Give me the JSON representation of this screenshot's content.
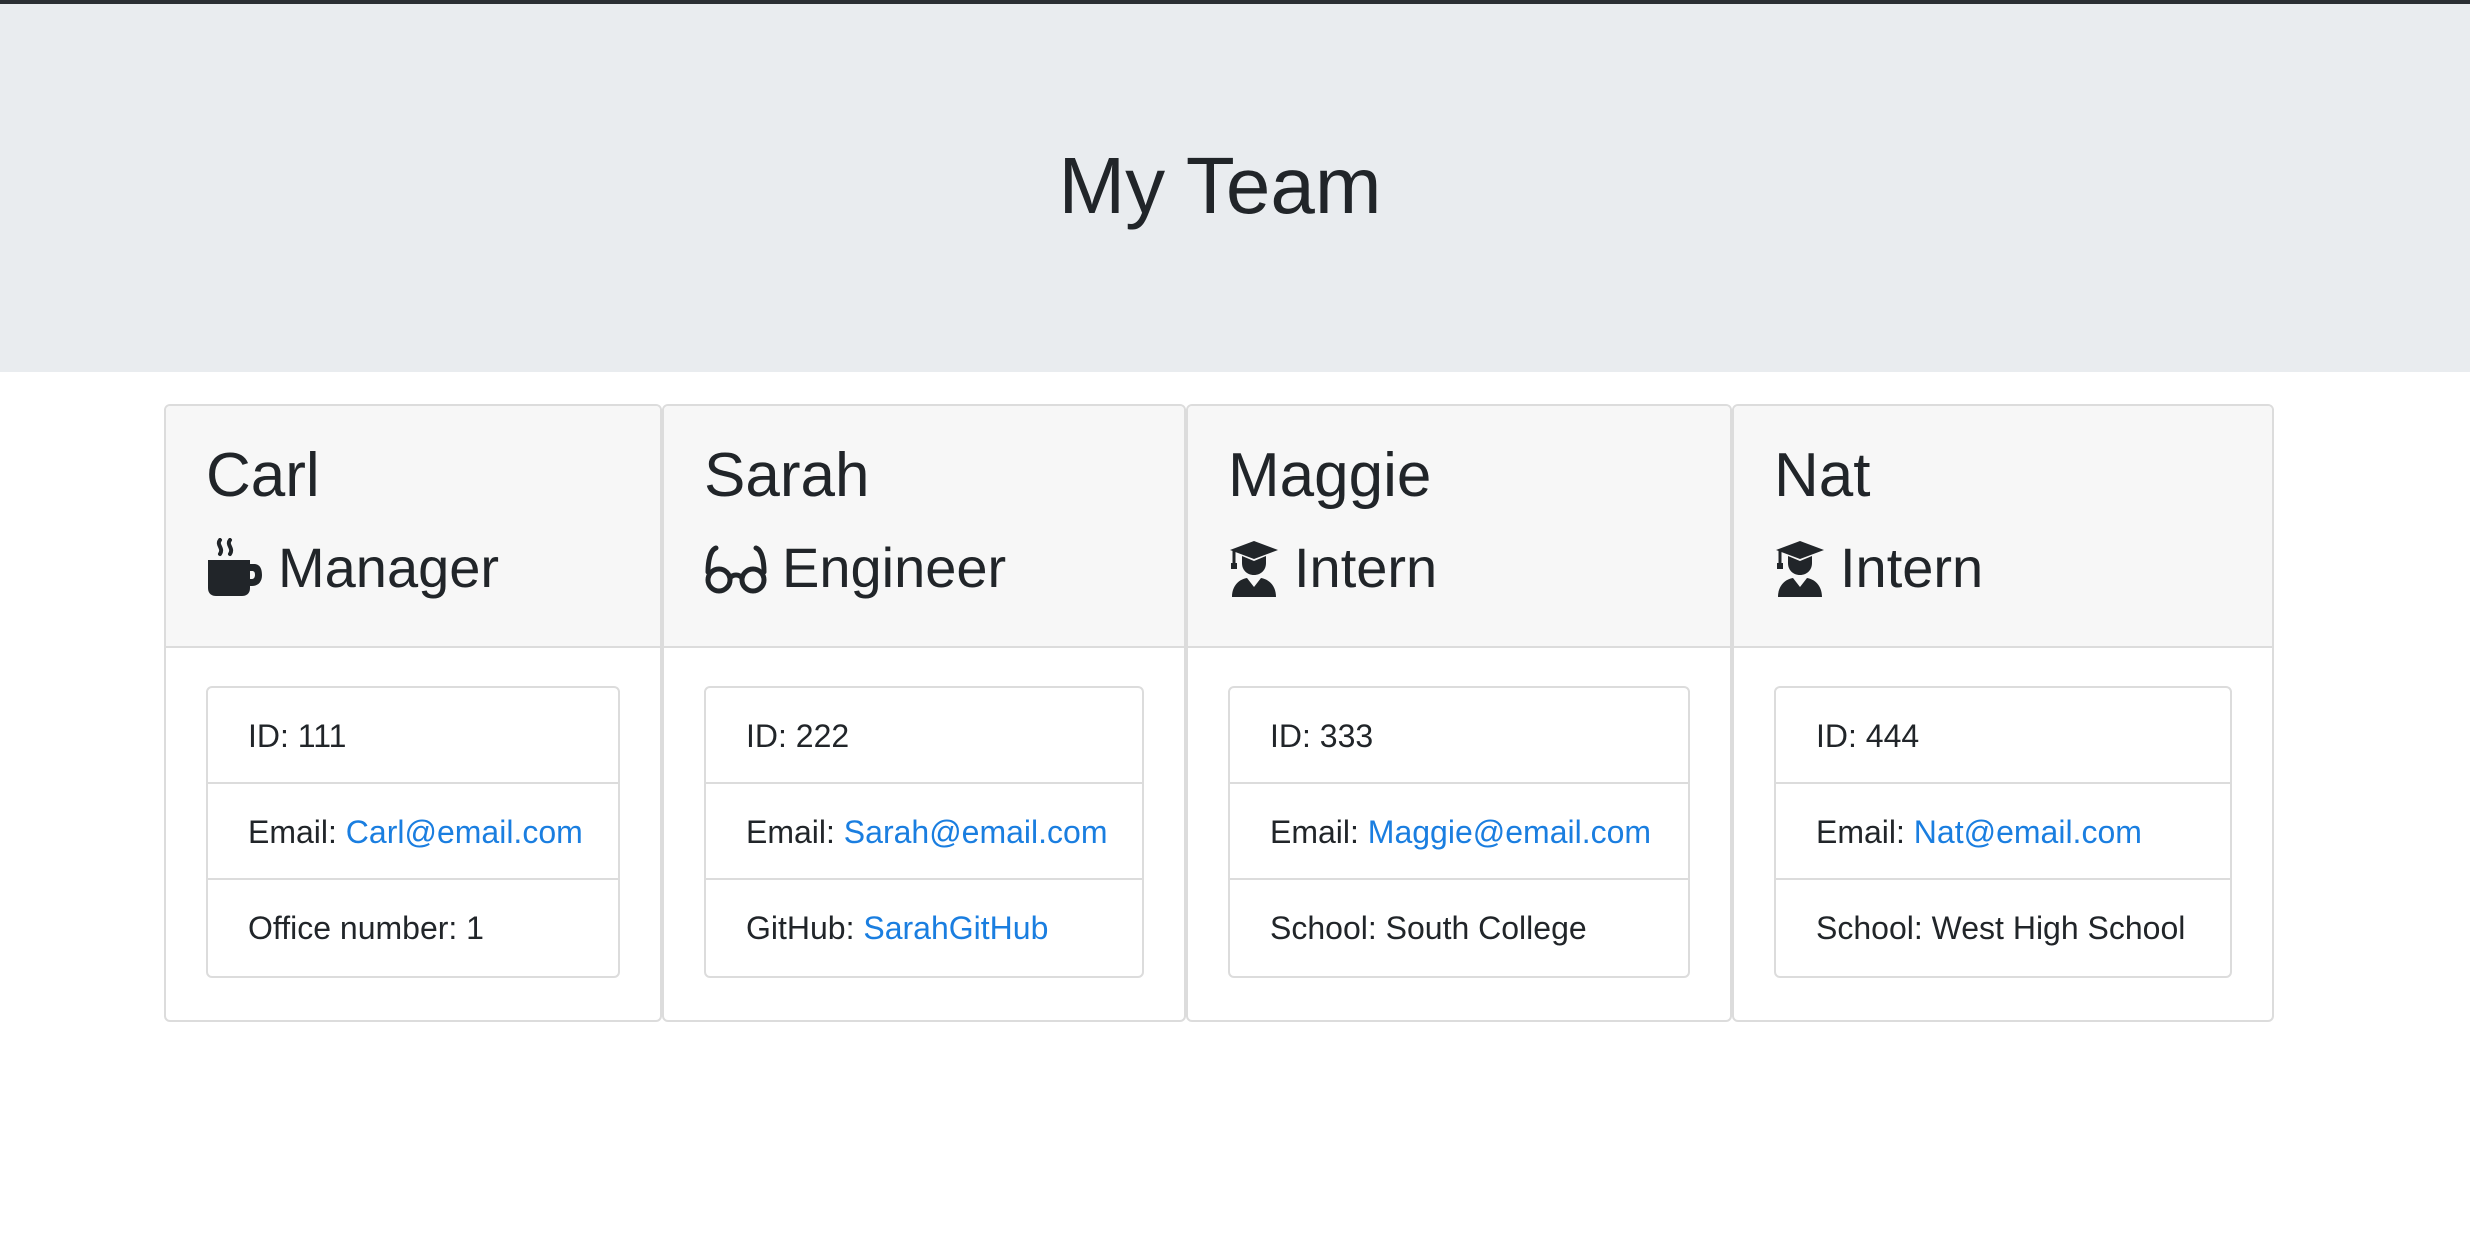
{
  "header": {
    "title": "My Team"
  },
  "cards": [
    {
      "name": "Carl",
      "role": "Manager",
      "role_icon": "coffee-mug-icon",
      "id_label": "ID: ",
      "id": "111",
      "email_label": "Email: ",
      "email": "Carl@email.com",
      "extra_label": "Office number: ",
      "extra": "1"
    },
    {
      "name": "Sarah",
      "role": "Engineer",
      "role_icon": "glasses-icon",
      "id_label": "ID: ",
      "id": "222",
      "email_label": "Email: ",
      "email": "Sarah@email.com",
      "extra_label": "GitHub: ",
      "extra": "SarahGitHub"
    },
    {
      "name": "Maggie",
      "role": "Intern",
      "role_icon": "graduate-icon",
      "id_label": "ID: ",
      "id": "333",
      "email_label": "Email: ",
      "email": "Maggie@email.com",
      "extra_label": "School: ",
      "extra": "South College"
    },
    {
      "name": "Nat",
      "role": "Intern",
      "role_icon": "graduate-icon",
      "id_label": "ID: ",
      "id": "444",
      "email_label": "Email: ",
      "email": "Nat@email.com",
      "extra_label": "School: ",
      "extra": "West High School"
    }
  ],
  "colors": {
    "jumbotron_bg": "#e9ecef",
    "card_header_bg": "#f7f7f7",
    "link": "#1a7ee0",
    "text": "#212529"
  }
}
